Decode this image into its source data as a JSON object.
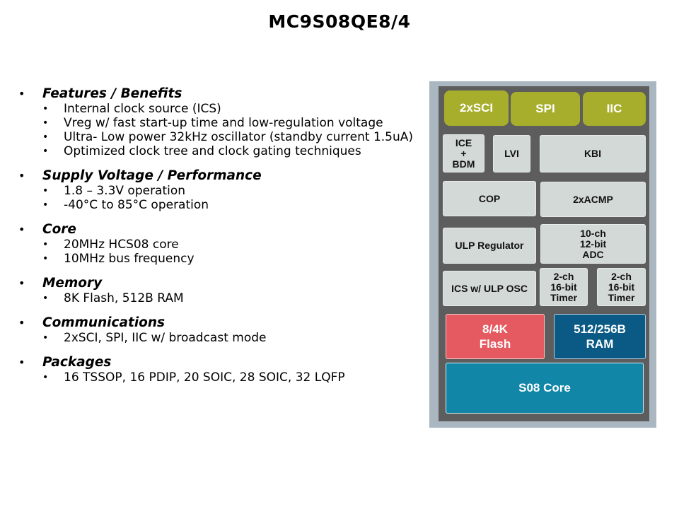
{
  "title": "MC9S08QE8/4",
  "sections": [
    {
      "heading": "Features / Benefits",
      "items": [
        "Internal clock source (ICS)",
        "Vreg w/ fast start-up time and low-regulation voltage",
        "Ultra- Low power 32kHz oscillator (standby current 1.5uA)",
        "Optimized clock tree and clock gating techniques"
      ]
    },
    {
      "heading": "Supply Voltage / Performance",
      "items": [
        "1.8 – 3.3V operation",
        "-40°C to 85°C operation"
      ]
    },
    {
      "heading": "Core",
      "items": [
        "20MHz HCS08 core",
        "10MHz bus frequency"
      ]
    },
    {
      "heading": "Memory",
      "items": [
        "8K Flash, 512B RAM"
      ]
    },
    {
      "heading": "Communications",
      "items": [
        "2xSCI, SPI, IIC w/ broadcast mode"
      ]
    },
    {
      "heading": "Packages",
      "items": [
        "16 TSSOP, 16 PDIP, 20 SOIC, 28 SOIC, 32 LQFP"
      ]
    }
  ],
  "bullet_glyph": "•",
  "diagram": {
    "sci": "2xSCI",
    "spi": "SPI",
    "iic": "IIC",
    "ice": [
      "ICE",
      "+",
      "BDM"
    ],
    "lvi": "LVI",
    "kbi": "KBI",
    "cop": "COP",
    "acmp": "2xACMP",
    "ulp_regulator": "ULP Regulator",
    "adc": [
      "10-ch",
      "12-bit",
      "ADC"
    ],
    "ics": "ICS w/ ULP OSC",
    "timer1": [
      "2-ch",
      "16-bit",
      "Timer"
    ],
    "timer2": [
      "2-ch",
      "16-bit",
      "Timer"
    ],
    "flash": [
      "8/4K",
      "Flash"
    ],
    "ram": [
      "512/256B",
      "RAM"
    ],
    "core": "S08 Core",
    "colors": {
      "comm": "#a7ae2c",
      "peripheral": "#d3d9d6",
      "flash": "#e45a60",
      "ram": "#0b5a86",
      "core": "#1286a6",
      "frame": "#aab6c0",
      "inner": "#5d5d5d"
    }
  }
}
